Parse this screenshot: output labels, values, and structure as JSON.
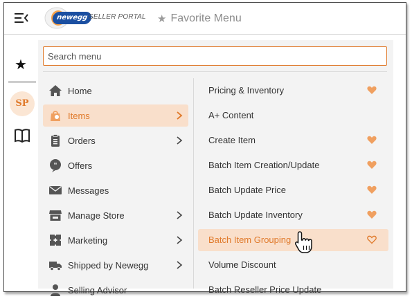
{
  "header": {
    "logo_brand": "newegg",
    "logo_portal": "SELLER PORTAL",
    "favorite_menu_label": "Favorite Menu"
  },
  "rail": {
    "avatar_initials": "SP"
  },
  "search": {
    "placeholder": "Search menu"
  },
  "categories": [
    {
      "label": "Home",
      "icon": "home-icon",
      "has_submenu": false,
      "active": false
    },
    {
      "label": "Items",
      "icon": "shopping-bag-icon",
      "has_submenu": true,
      "active": true
    },
    {
      "label": "Orders",
      "icon": "clipboard-icon",
      "has_submenu": true,
      "active": false
    },
    {
      "label": "Offers",
      "icon": "offers-quote-icon",
      "has_submenu": false,
      "active": false
    },
    {
      "label": "Messages",
      "icon": "envelope-icon",
      "has_submenu": false,
      "active": false
    },
    {
      "label": "Manage Store",
      "icon": "storefront-icon",
      "has_submenu": true,
      "active": false
    },
    {
      "label": "Marketing",
      "icon": "puzzle-icon",
      "has_submenu": true,
      "active": false
    },
    {
      "label": "Shipped by Newegg",
      "icon": "truck-icon",
      "has_submenu": true,
      "active": false
    },
    {
      "label": "Selling Advisor",
      "icon": "advisor-icon",
      "has_submenu": false,
      "active": false
    }
  ],
  "submenu": [
    {
      "label": "Pricing & Inventory",
      "favorited": true,
      "active": false
    },
    {
      "label": "A+ Content",
      "favorited": false,
      "active": false
    },
    {
      "label": "Create Item",
      "favorited": true,
      "active": false
    },
    {
      "label": "Batch Item Creation/Update",
      "favorited": true,
      "active": false
    },
    {
      "label": "Batch Update Price",
      "favorited": true,
      "active": false
    },
    {
      "label": "Batch Update Inventory",
      "favorited": true,
      "active": false
    },
    {
      "label": "Batch Item Grouping",
      "favorited": false,
      "active": true,
      "heart_outline": true
    },
    {
      "label": "Volume Discount",
      "favorited": false,
      "active": false
    },
    {
      "label": "Batch Reseller Price Update",
      "favorited": false,
      "active": false
    }
  ],
  "colors": {
    "accent": "#e07a2b",
    "heart": "#f0a060",
    "active_bg": "#f9dfcb",
    "brand_blue": "#1b4fa1"
  }
}
